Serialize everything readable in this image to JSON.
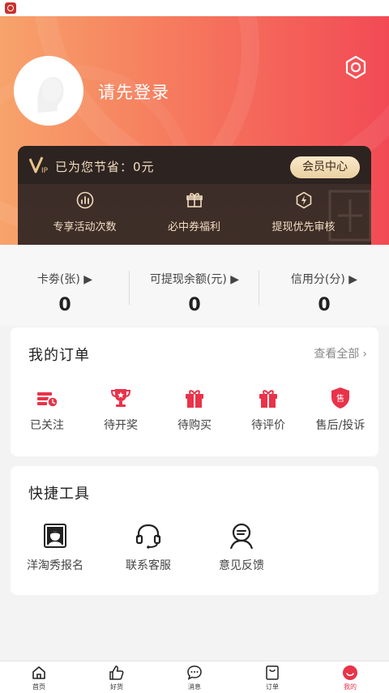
{
  "user": {
    "login_prompt": "请先登录"
  },
  "vip": {
    "saved_text": "已为您节省：0元",
    "member_center_label": "会员中心",
    "benefits": [
      {
        "label": "专享活动次数",
        "icon": "chart-icon"
      },
      {
        "label": "必中券福利",
        "icon": "gift-icon"
      },
      {
        "label": "提现优先审核",
        "icon": "lightning-shield-icon"
      }
    ]
  },
  "stats": [
    {
      "label": "卡劵(张)",
      "value": "0"
    },
    {
      "label": "可提现余额(元)",
      "value": "0"
    },
    {
      "label": "信用分(分)",
      "value": "0"
    }
  ],
  "orders": {
    "title": "我的订单",
    "view_all": "查看全部",
    "items": [
      {
        "label": "已关注",
        "icon": "followed-icon"
      },
      {
        "label": "待开奖",
        "icon": "trophy-icon"
      },
      {
        "label": "待购买",
        "icon": "gift-box-icon"
      },
      {
        "label": "待评价",
        "icon": "gift-box-icon"
      },
      {
        "label": "售后/投诉",
        "icon": "after-sale-shield-icon"
      }
    ]
  },
  "tools": {
    "title": "快捷工具",
    "items": [
      {
        "label": "洋淘秀报名",
        "icon": "photo-frame-icon"
      },
      {
        "label": "联系客服",
        "icon": "headset-icon"
      },
      {
        "label": "意见反馈",
        "icon": "feedback-person-icon"
      }
    ]
  },
  "tabbar": [
    {
      "label": "首页",
      "icon": "home-icon"
    },
    {
      "label": "好货",
      "icon": "thumbs-up-icon"
    },
    {
      "label": "消息",
      "icon": "message-icon"
    },
    {
      "label": "订单",
      "icon": "order-bag-icon"
    },
    {
      "label": "我的",
      "icon": "profile-face-icon",
      "active": true
    }
  ],
  "colors": {
    "accent": "#e8334a",
    "header_start": "#f7a36b",
    "header_end": "#f24a55",
    "vip_bg": "#3b2c27",
    "vip_text": "#f1dcc0"
  }
}
